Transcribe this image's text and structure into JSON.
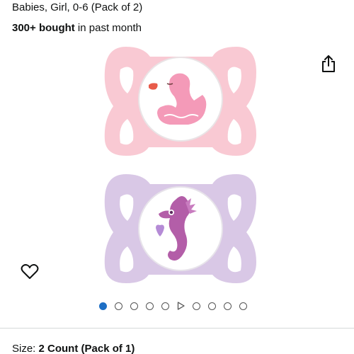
{
  "product": {
    "title_tail": "Babies, Girl, 0-6 (Pack of 2)",
    "bought_count": "300+ bought",
    "bought_suffix": " in past month"
  },
  "icons": {
    "share": "share-icon",
    "wishlist": "heart-icon",
    "video": "play-icon"
  },
  "carousel": {
    "total_items": 10,
    "active_index": 0,
    "video_index": 5
  },
  "variation": {
    "label": "Size: ",
    "value": "2 Count (Pack of 1)"
  },
  "colors": {
    "active_dot": "#1e6fc5",
    "pacifier_pink": "#f9c9d3",
    "pacifier_lilac": "#d9c8e6",
    "duck_pink": "#f08fb0",
    "seahorse_purple": "#b35ea8"
  }
}
